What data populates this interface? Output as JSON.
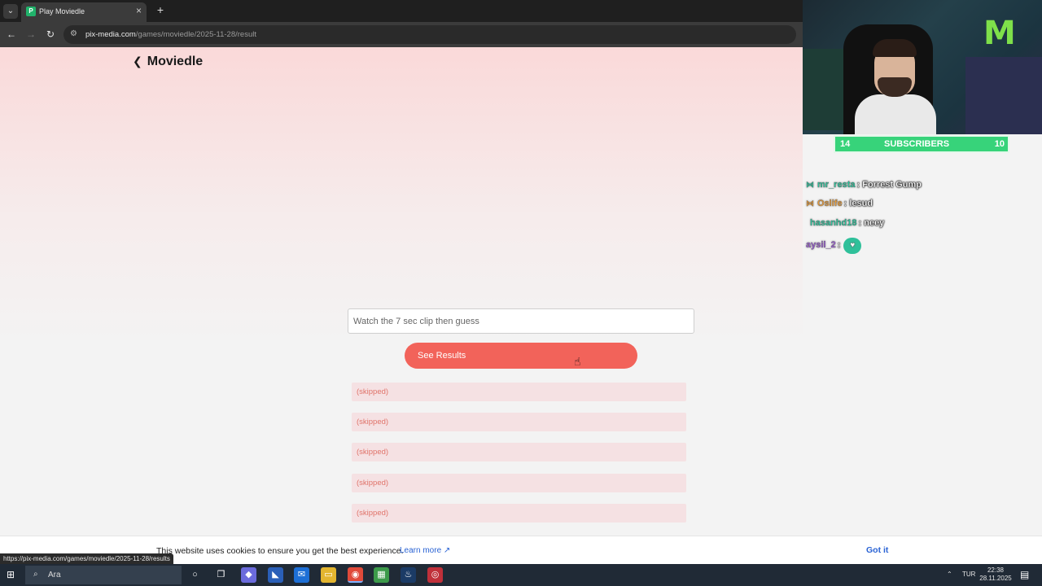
{
  "browser": {
    "tab_title": "Play Moviedle",
    "tab_favicon": "P",
    "url_host": "pix-media.com",
    "url_path": "/games/moviedle/2025-11-28/result",
    "status_url": "https://pix-media.com/games/moviedle/2025-11-28/results"
  },
  "page": {
    "back_label": "Moviedle",
    "guess_placeholder": "Watch the 7 sec clip then guess",
    "see_results_label": "See Results",
    "accent_color": "#f2635a",
    "attempts": [
      "(skipped)",
      "(skipped)",
      "(skipped)",
      "(skipped)",
      "(skipped)"
    ]
  },
  "cookie": {
    "text": "This website uses cookies to ensure you get the best experience.",
    "learn_more": "Learn more",
    "got_it": "Got it"
  },
  "taskbar": {
    "search_label": "Ara",
    "language": "TUR",
    "time": "22:38",
    "date": "28.11.2025"
  },
  "overlay": {
    "subs_left": "14",
    "subs_label": "SUBSCRIBERS",
    "subs_right": "10",
    "chat": [
      {
        "user": "mr_resta",
        "separator": ":",
        "message": "Forrest Gump",
        "color": "#2fc09a",
        "badge": "⋈"
      },
      {
        "user": "Oslife",
        "separator": ":",
        "message": "lesud",
        "color": "#e39a3c",
        "badge": "⋈"
      },
      {
        "user": "hasanhd18",
        "separator": ":",
        "message": "neey",
        "color": "#2fc09a",
        "badge": ""
      },
      {
        "user": "aysil_2",
        "separator": ":",
        "message": "",
        "color": "#9a5fd0",
        "badge": ""
      }
    ]
  }
}
